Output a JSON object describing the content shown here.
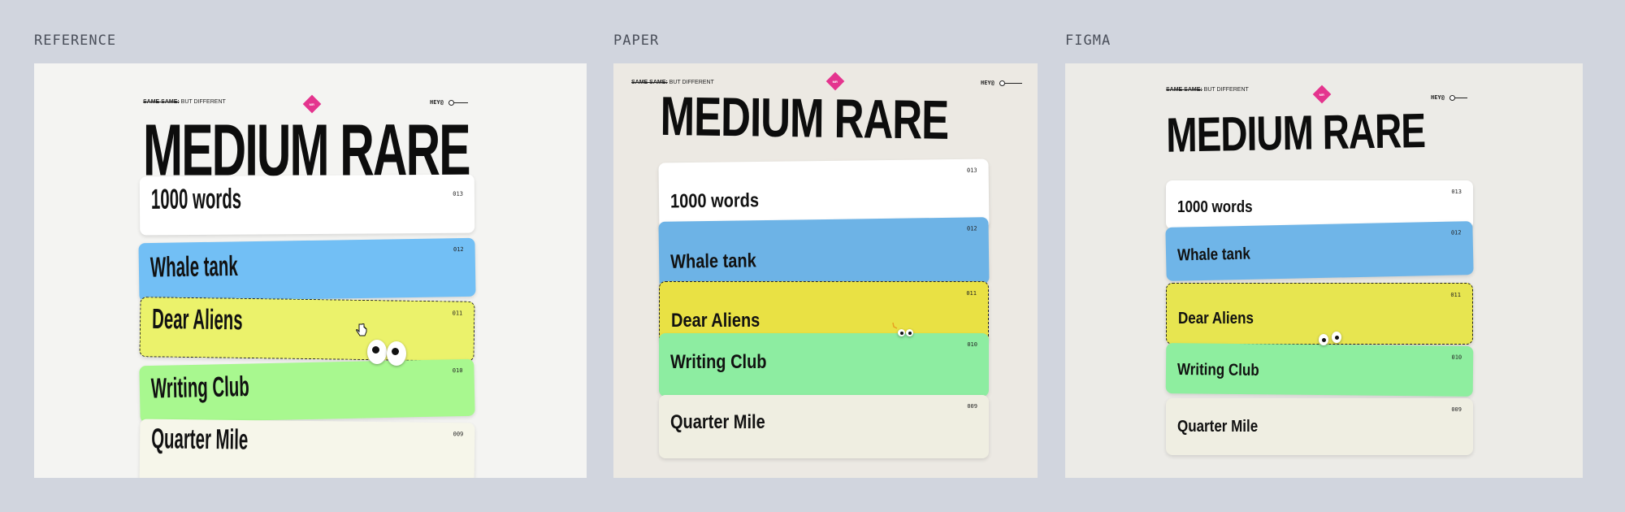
{
  "columns": {
    "reference": "REFERENCE",
    "paper": "PAPER",
    "figma": "FIGMA"
  },
  "site": {
    "header_strike": "SAME SAME:",
    "header_rest": " BUT DIFFERENT",
    "header_right": "HEY@",
    "logo_text": "MR",
    "title": "MEDIUM RARE"
  },
  "cards": [
    {
      "label": "1000 words",
      "number": "013",
      "color": "#ffffff"
    },
    {
      "label": "Whale tank",
      "number": "012",
      "color": "#72bff5"
    },
    {
      "label": "Dear Aliens",
      "number": "011",
      "color": "#ebf26b"
    },
    {
      "label": "Writing Club",
      "number": "010",
      "color": "#a8f88f"
    },
    {
      "label": "Quarter Mile",
      "number": "009",
      "color": "#f6f6ea"
    }
  ],
  "paper_colors": [
    "#ffffff",
    "#6db3e6",
    "#e9e144",
    "#8deda1",
    "#efeee1"
  ],
  "figma_colors": [
    "#ffffff",
    "#6fb5e8",
    "#e7e550",
    "#8eee9f",
    "#efeee2"
  ],
  "icons": {
    "logo": "diamond-logo-icon",
    "cursor": "hand-cursor-icon",
    "eyes": "googly-eyes-icon",
    "toggle": "toggle-icon"
  }
}
